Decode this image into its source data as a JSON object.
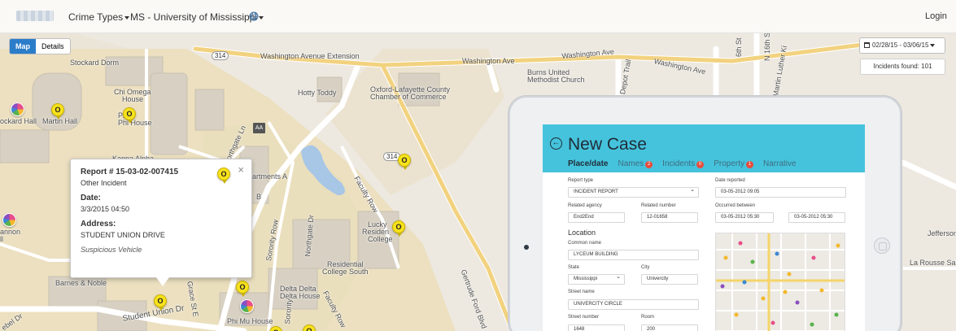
{
  "navbar": {
    "menu_crime_types": "Crime Types",
    "menu_university": "MS - University of Mississippi",
    "login": "Login"
  },
  "view_toggle": {
    "map": "Map",
    "details": "Details",
    "selected": "Map"
  },
  "date_range": "02/28/15 - 03/06/15",
  "incidents_found": "Incidents found: 101",
  "map_labels": {
    "stockard_dorm": "Stockard Dorm",
    "chi_omega_1": "Chi Omega",
    "chi_omega_2": "House",
    "phi": "Phi",
    "phi_house": "Phi House",
    "stockard_hall": "ockard Hall",
    "martin_hall": "Martin Hall",
    "kappa_alpha": "Kappa Alpha",
    "washington_ave_ext": "Washington Avenue Extension",
    "washington_ave": "Washington Ave",
    "washington_ave_2": "Washington Ave",
    "washington_ave_3": "Washington Ave",
    "hotty_toddy": "Hotty Toddy",
    "oxford_chamber_1": "Oxford-Lafayette County",
    "oxford_chamber_2": "Chamber of Commerce",
    "burns_1": "Burns United",
    "burns_2": "Methodist Church",
    "depot_trail": "Depot Trail",
    "sixth_st": "6th St",
    "n16th_st": "N 16th St",
    "mlk": "Martin Luther Ki",
    "northgate_ln": "Northgate Ln",
    "apartments": "artments A",
    "b": "B",
    "faculty_row": "Faculty Row",
    "lucky_1": "Lucky",
    "lucky_2": "Residen",
    "lucky_3": "College",
    "sorority_row": "Sorority Row",
    "northgate_dr": "Northgate Dr",
    "residential_1": "Residential",
    "residential_2": "College South",
    "delta_delta_1": "Delta Delta",
    "delta_delta_2": "Delta House",
    "barnes": "Barnes & Noble",
    "student_union": "Student Union Dr",
    "phi_mu": "Phi Mu House",
    "gertrude": "Gertrude Ford Blvd",
    "jefferson": "Jefferson",
    "la_rousse": "La Rousse Salon &",
    "ebel": "ebel Dr",
    "cannon_1": "annon",
    "cannon_2": "ll",
    "sorority_2": "Sorority",
    "faculty_2": "Faculty Row",
    "grace": "Grace St E",
    "hwy_314": "314",
    "hwy_314b": "314",
    "aa": "AA"
  },
  "marker_letter": "O",
  "popup": {
    "report": "Report # 15-03-02-007415",
    "type": "Other Incident",
    "date_label": "Date:",
    "date_value": "3/3/2015 04:50",
    "address_label": "Address:",
    "address_value": "STUDENT UNION DRIVE",
    "note": "Suspicious Vehicle",
    "close": "×"
  },
  "case_form": {
    "title": "New Case",
    "back": "←",
    "tabs": [
      {
        "label": "Place/date"
      },
      {
        "label": "Names",
        "badge": "2"
      },
      {
        "label": "Incidents",
        "badge": "0"
      },
      {
        "label": "Property",
        "badge": "1"
      },
      {
        "label": "Narrative"
      }
    ],
    "report_type_label": "Report type",
    "report_type_value": "INCIDENT REPORT",
    "date_reported_label": "Date reported",
    "date_reported_value": "03-05-2012  09:05",
    "related_agency_label": "Related agency",
    "related_agency_value": "End2End",
    "related_number_label": "Related number",
    "related_number_value": "12-01658",
    "occurred_between_label": "Occurred between",
    "occurred_from": "03-05-2012  05:30",
    "occurred_to": "03-05-2012  05:30",
    "location_heading": "Location",
    "common_name_label": "Common name",
    "common_name_value": "LYCEUM BUILDING",
    "state_label": "State",
    "state_value": "Mississippi",
    "city_label": "City",
    "city_value": "Univercity",
    "street_name_label": "Street name",
    "street_name_value": "UNIVERCITY CIRCLE",
    "street_number_label": "Street number",
    "street_number_value": "1648",
    "room_label": "Room",
    "room_value": "200"
  }
}
